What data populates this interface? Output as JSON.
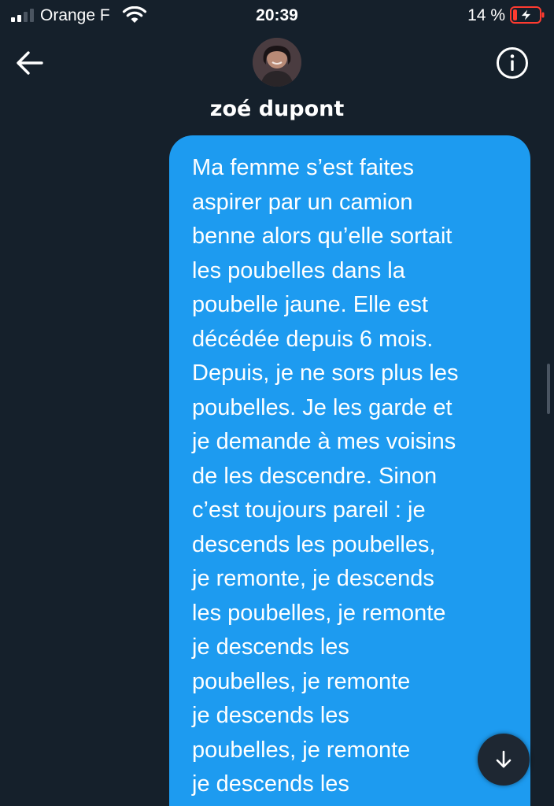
{
  "status_bar": {
    "carrier": "Orange F",
    "time": "20:39",
    "battery": "14 %",
    "battery_level": 0.14,
    "signal_bars_active": 2,
    "signal_bars_total": 4,
    "icons": [
      "signal-icon",
      "wifi-icon",
      "battery-charging-icon"
    ]
  },
  "header": {
    "contact_name": "zoé dupont",
    "icons": [
      "back-arrow-icon",
      "info-icon"
    ]
  },
  "conversation": {
    "messages": [
      {
        "sender": "self",
        "text": "Ma femme s’est faites\naspirer par un camion\nbenne alors qu’elle sortait\nles poubelles dans la\npoubelle jaune. Elle est\ndécédée depuis 6 mois.\nDepuis, je ne sors plus les\npoubelles. Je les garde et\nje demande à mes voisins\nde les descendre. Sinon\nc’est toujours pareil : je\ndescends les poubelles,\nje remonte, je descends\nles poubelles, je remonte\nje descends les\npoubelles, je remonte\nje descends les\npoubelles, je remonte\nje descends les"
      }
    ]
  },
  "controls": {
    "scroll_down_icon": "arrow-down-icon"
  },
  "colors": {
    "background": "#15202b",
    "bubble": "#1d9bf0",
    "battery_low": "#ff3b30"
  }
}
